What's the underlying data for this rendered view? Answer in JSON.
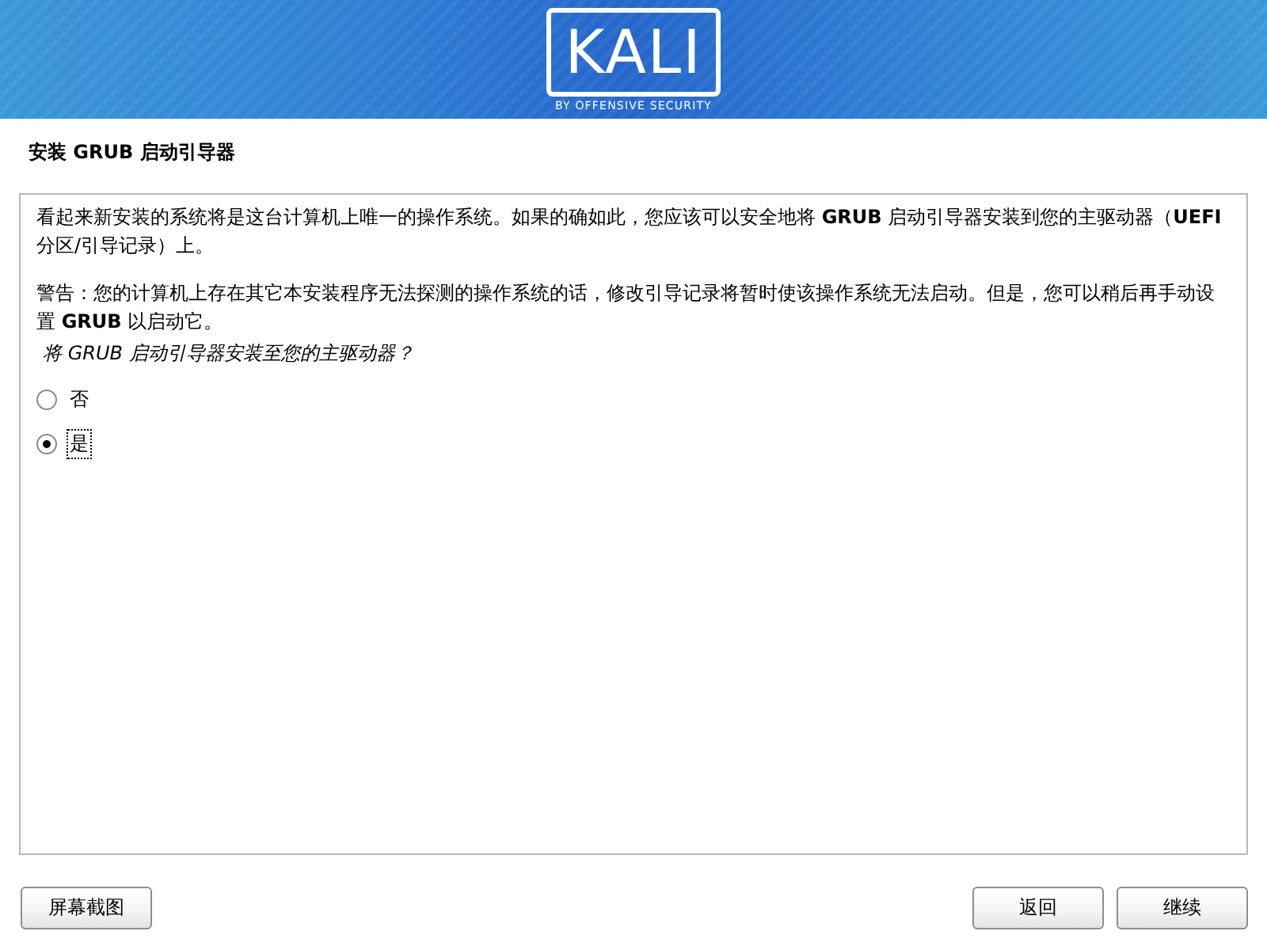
{
  "header": {
    "logo_title": "KALI",
    "logo_tagline": "BY OFFENSIVE SECURITY"
  },
  "page_title": "安装 GRUB 启动引导器",
  "paragraphs": [
    "看起来新安装的系统将是这台计算机上唯一的操作系统。如果的确如此，您应该可以安全地将 **GRUB** 启动引导器安装到您的主驱动器（**UEFI** 分区/引导记录）上。",
    "警告：您的计算机上存在其它本安装程序无法探测的操作系统的话，修改引导记录将暂时使该操作系统无法启动。但是，您可以稍后再手动设置 **GRUB** 以启动它。"
  ],
  "question": "将 GRUB 启动引导器安装至您的主驱动器？",
  "options": [
    {
      "label": "否",
      "selected": false,
      "focused": false
    },
    {
      "label": "是",
      "selected": true,
      "focused": true
    }
  ],
  "buttons": {
    "screenshot": "屏幕截图",
    "back": "返回",
    "continue": "继续"
  }
}
